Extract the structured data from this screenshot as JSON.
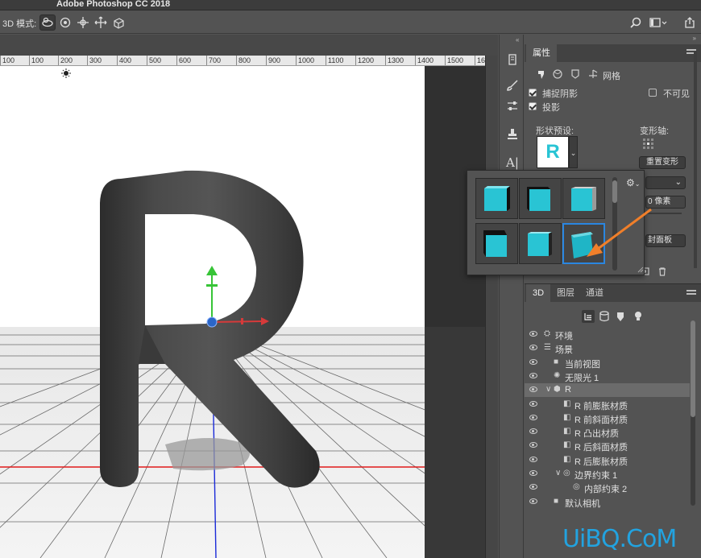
{
  "app": {
    "title": "Adobe Photoshop CC 2018"
  },
  "options_bar": {
    "mode_label": "3D 模式:",
    "mode_icons": [
      "orbit-3d-icon",
      "roll-3d-icon",
      "drag-3d-icon",
      "slide-3d-icon",
      "scale-3d-icon"
    ],
    "right_icons": [
      "search-icon",
      "workspace-icon",
      "share-icon"
    ]
  },
  "ruler": {
    "ticks": [
      "100",
      "100",
      "200",
      "300",
      "400",
      "500",
      "600",
      "700",
      "800",
      "900",
      "1000",
      "1100",
      "1200",
      "1300",
      "1400",
      "1500",
      "16"
    ]
  },
  "tools": [
    "history-icon",
    "brush-preset-icon",
    "adjust-icon",
    "clone-source-icon",
    "character-icon"
  ],
  "properties": {
    "tab_label": "属性",
    "subtabs": [
      "mesh-icon",
      "deform-icon",
      "cap-icon",
      "coordinates-icon"
    ],
    "subtab_label": "网格",
    "catch_shadows": "捕捉阴影",
    "invisible": "不可见",
    "cast_shadows": "投影",
    "shape_preset_label": "形状预设:",
    "preset_letter": "R",
    "deform_axis_label": "变形轴:",
    "reset_deform": "重置变形",
    "depth_value": "0 像素",
    "edit_panel": "封面板"
  },
  "preset_popup": {
    "thumbs": [
      "preset-1",
      "preset-2",
      "preset-3",
      "preset-4",
      "preset-5",
      "preset-6"
    ],
    "selected_index": 5
  },
  "scene_panel": {
    "tabs": [
      "3D",
      "图层",
      "通道"
    ],
    "filter_icons": [
      "scene-filter-icon",
      "mesh-filter-icon",
      "material-filter-icon",
      "light-filter-icon"
    ],
    "rows": [
      {
        "label": "环境",
        "icon": "environment-icon",
        "indent": 0,
        "arrow": ""
      },
      {
        "label": "场景",
        "icon": "scene-icon",
        "indent": 0,
        "arrow": ""
      },
      {
        "label": "当前视图",
        "icon": "camera-icon",
        "indent": 1,
        "arrow": ""
      },
      {
        "label": "无限光 1",
        "icon": "light-icon",
        "indent": 1,
        "arrow": ""
      },
      {
        "label": "R",
        "icon": "mesh-icon",
        "indent": 1,
        "arrow": "∨"
      },
      {
        "label": "R 前膨胀材质",
        "icon": "material-icon",
        "indent": 2,
        "arrow": ""
      },
      {
        "label": "R 前斜面材质",
        "icon": "material-icon",
        "indent": 2,
        "arrow": ""
      },
      {
        "label": "R 凸出材质",
        "icon": "material-icon",
        "indent": 2,
        "arrow": ""
      },
      {
        "label": "R 后斜面材质",
        "icon": "material-icon",
        "indent": 2,
        "arrow": ""
      },
      {
        "label": "R 后膨胀材质",
        "icon": "material-icon",
        "indent": 2,
        "arrow": ""
      },
      {
        "label": "边界约束 1",
        "icon": "constraint-icon",
        "indent": 2,
        "arrow": "∨"
      },
      {
        "label": "内部约束 2",
        "icon": "constraint-icon",
        "indent": 3,
        "arrow": ""
      },
      {
        "label": "默认相机",
        "icon": "camera-icon",
        "indent": 1,
        "arrow": ""
      }
    ],
    "selected_index": 4
  },
  "watermark": "UiBQ.CoM",
  "colors": {
    "accent": "#2a86e0",
    "cyan": "#29c4d4",
    "arrow": "#f07f2a"
  }
}
